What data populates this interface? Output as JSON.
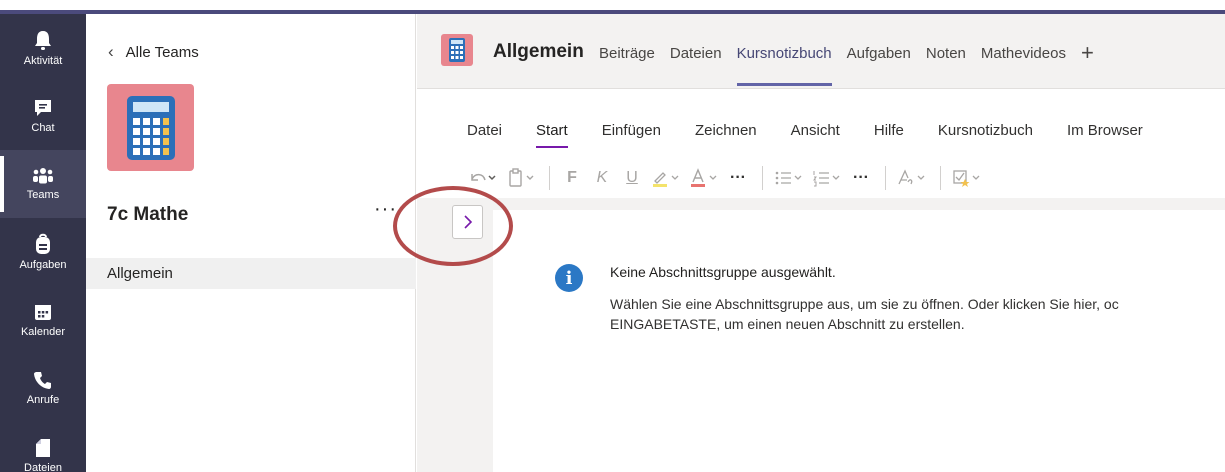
{
  "rail": {
    "items": [
      {
        "label": "Aktivität",
        "icon": "bell-icon"
      },
      {
        "label": "Chat",
        "icon": "chat-icon"
      },
      {
        "label": "Teams",
        "icon": "teams-icon",
        "active": true
      },
      {
        "label": "Aufgaben",
        "icon": "backpack-icon"
      },
      {
        "label": "Kalender",
        "icon": "calendar-icon"
      },
      {
        "label": "Anrufe",
        "icon": "phone-icon"
      },
      {
        "label": "Dateien",
        "icon": "file-icon"
      }
    ]
  },
  "team_panel": {
    "back_label": "Alle Teams",
    "team_name": "7c Mathe",
    "more_label": "···",
    "channels": [
      "Allgemein"
    ]
  },
  "header": {
    "channel_title": "Allgemein",
    "tabs": [
      "Beiträge",
      "Dateien",
      "Kursnotizbuch",
      "Aufgaben",
      "Noten",
      "Mathevideos"
    ],
    "active_tab": "Kursnotizbuch",
    "add_tab": "+"
  },
  "ribbon": {
    "menu": [
      "Datei",
      "Start",
      "Einfügen",
      "Zeichnen",
      "Ansicht",
      "Hilfe",
      "Kursnotizbuch",
      "Im Browser"
    ],
    "active_menu": "Start",
    "toolbar": {
      "bold": "F",
      "italic": "K",
      "underline": "U",
      "more1": "···",
      "more2": "···"
    }
  },
  "notebook": {
    "toggle_label": ">",
    "info_title": "Keine Abschnittsgruppe ausgewählt.",
    "info_line1": "Wählen Sie eine Abschnittsgruppe aus, um sie zu öffnen. Oder klicken Sie hier, oc",
    "info_line2": "EINGABETASTE, um einen neuen Abschnitt zu erstellen."
  },
  "colors": {
    "rail_bg": "#33344a",
    "accent": "#6264a7",
    "avatar": "#e8868e",
    "annotation": "#b34b4b"
  }
}
